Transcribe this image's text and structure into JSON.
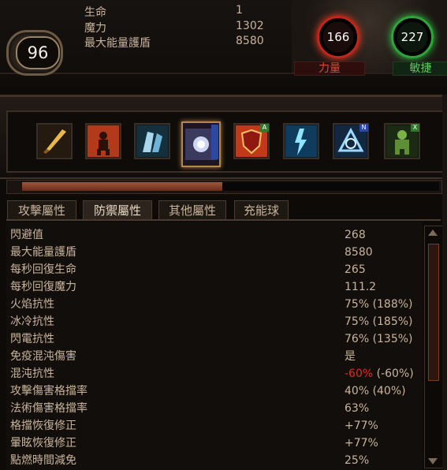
{
  "header": {
    "level": "96",
    "stats": [
      {
        "label": "生命",
        "value": "1"
      },
      {
        "label": "魔力",
        "value": "1302"
      },
      {
        "label": "最大能量護盾",
        "value": "8580"
      }
    ]
  },
  "attributes": {
    "strength": {
      "value": "166",
      "label": "力量",
      "color": "#c2261b"
    },
    "dexterity": {
      "value": "227",
      "label": "敏捷",
      "color": "#2fa43a"
    }
  },
  "skill_gems": [
    {
      "icon": "sword-skill-icon",
      "tag": ""
    },
    {
      "icon": "fire-warrior-skill-icon",
      "tag": ""
    },
    {
      "icon": "ice-figure-skill-icon",
      "tag": ""
    },
    {
      "icon": "frost-orb-skill-icon",
      "tag": "",
      "selected": true
    },
    {
      "icon": "shield-skill-icon",
      "tag": "A"
    },
    {
      "icon": "lightning-figure-skill-icon",
      "tag": ""
    },
    {
      "icon": "arcane-triangle-skill-icon",
      "tag": "N"
    },
    {
      "icon": "golem-skill-icon",
      "tag": "X"
    }
  ],
  "progress": {
    "fraction": 0.48
  },
  "tabs": [
    {
      "label": "攻擊屬性",
      "active": false
    },
    {
      "label": "防禦屬性",
      "active": true
    },
    {
      "label": "其他屬性",
      "active": false
    },
    {
      "label": "充能球",
      "active": false
    }
  ],
  "defense_stats": [
    {
      "name": "閃避值",
      "value": "268"
    },
    {
      "name": "最大能量護盾",
      "value": "8580"
    },
    {
      "name": "每秒回復生命",
      "value": "265"
    },
    {
      "name": "每秒回復魔力",
      "value": "111.2"
    },
    {
      "name": "火焰抗性",
      "value": "75% (188%)"
    },
    {
      "name": "冰冷抗性",
      "value": "75% (185%)"
    },
    {
      "name": "閃電抗性",
      "value": "76% (135%)"
    },
    {
      "name": "免疫混沌傷害",
      "value": "是"
    },
    {
      "name": "混沌抗性",
      "value_neg": "-60%",
      "value": " (-60%)"
    },
    {
      "name": "攻擊傷害格擋率",
      "value": "40% (40%)"
    },
    {
      "name": "法術傷害格擋率",
      "value": "63%"
    },
    {
      "name": "格擋恢復修正",
      "value": "+77%"
    },
    {
      "name": "暈眩恢復修正",
      "value": "+77%"
    },
    {
      "name": "點燃時間減免",
      "value": "25%"
    }
  ]
}
